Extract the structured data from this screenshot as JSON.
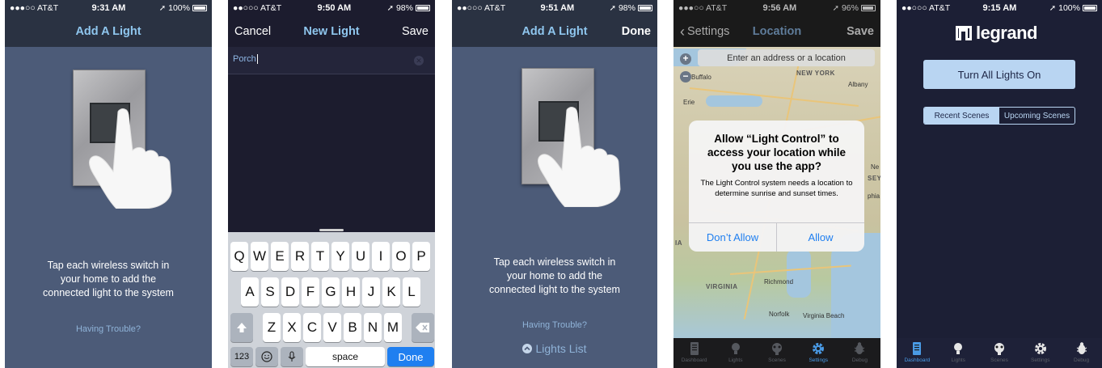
{
  "screens": {
    "add_light_1": {
      "status": {
        "carrier": "●●●○○ AT&T",
        "time": "9:31 AM",
        "battery": "100%",
        "battery_fill": 1.0
      },
      "title": "Add A Light",
      "instruction": "Tap each wireless switch in your home to add the connected light to the system",
      "trouble_link": "Having Trouble?"
    },
    "new_light": {
      "status": {
        "carrier": "●●○○○ AT&T",
        "time": "9:50 AM",
        "battery": "98%",
        "battery_fill": 0.98
      },
      "cancel": "Cancel",
      "title": "New Light",
      "save": "Save",
      "input_value": "Porch",
      "keyboard": {
        "row1": [
          "Q",
          "W",
          "E",
          "R",
          "T",
          "Y",
          "U",
          "I",
          "O",
          "P"
        ],
        "row2": [
          "A",
          "S",
          "D",
          "F",
          "G",
          "H",
          "J",
          "K",
          "L"
        ],
        "row3": [
          "Z",
          "X",
          "C",
          "V",
          "B",
          "N",
          "M"
        ],
        "numbers": "123",
        "space": "space",
        "done": "Done"
      }
    },
    "add_light_2": {
      "status": {
        "carrier": "●●○○○ AT&T",
        "time": "9:51 AM",
        "battery": "98%",
        "battery_fill": 0.98
      },
      "title": "Add A Light",
      "done": "Done",
      "instruction": "Tap each wireless switch in your home to add the connected light to the system",
      "trouble_link": "Having Trouble?",
      "lights_list": "Lights List"
    },
    "location": {
      "status": {
        "carrier": "●●●○○ AT&T",
        "time": "9:56 AM",
        "battery": "96%",
        "battery_fill": 0.96
      },
      "back": "Settings",
      "title": "Location",
      "save": "Save",
      "search_placeholder": "Enter an address or a location",
      "map_labels": {
        "buffalo": "Buffalo",
        "new_york": "NEW YORK",
        "albany": "Albany",
        "erie": "Erie",
        "virginia": "VIRGINIA",
        "richmond": "Richmond",
        "norfolk": "Norfolk",
        "virginia_beach": "Virginia Beach",
        "ne": "Ne",
        "sey": "SEY",
        "phia": "phia",
        "ia": "IA"
      },
      "alert": {
        "title": "Allow “Light Control” to access your location while you use the app?",
        "message": "The Light Control system needs a location to determine sunrise and sunset times.",
        "dont_allow": "Don’t Allow",
        "allow": "Allow"
      },
      "tabs": [
        "Dashboard",
        "Lights",
        "Scenes",
        "Settings",
        "Debug"
      ],
      "active_tab": "Settings"
    },
    "dashboard": {
      "status": {
        "carrier": "●●○○○ AT&T",
        "time": "9:15 AM",
        "battery": "100%",
        "battery_fill": 1.0
      },
      "brand": "legrand",
      "all_on": "Turn All Lights On",
      "segments": [
        "Recent Scenes",
        "Upcoming Scenes"
      ],
      "selected_segment": "Recent Scenes",
      "tabs": [
        "Dashboard",
        "Lights",
        "Scenes",
        "Settings",
        "Debug"
      ],
      "active_tab": "Dashboard"
    }
  },
  "colors": {
    "accent_blue": "#8fc6ee",
    "ios_blue": "#1f7ff0",
    "add_light_bg": "#4c5b78",
    "dashboard_bg": "#1c1f35",
    "button_light": "#b9d5f2"
  },
  "icons": [
    "location-arrow-icon",
    "battery-icon",
    "wifi-icon",
    "chevron-left-icon",
    "clear-icon",
    "shift-icon",
    "backspace-icon",
    "emoji-icon",
    "mic-icon",
    "chevron-up-circle-icon",
    "dashboard-icon",
    "bulb-icon",
    "scenes-icon",
    "gear-icon",
    "bug-icon"
  ]
}
